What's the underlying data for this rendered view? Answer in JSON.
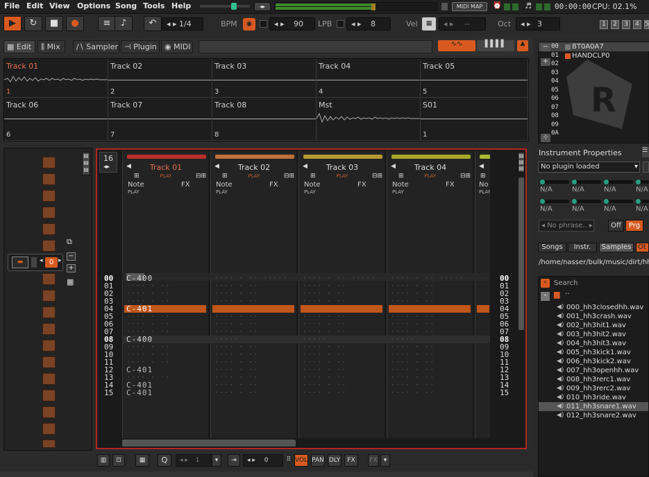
{
  "menu": [
    "File",
    "Edit",
    "View",
    "Options",
    "Song",
    "Tools",
    "Help"
  ],
  "status": {
    "midi_map": "MIDI MAP",
    "time": "00:00:00",
    "cpu": "CPU: 02.1%"
  },
  "toolbar": {
    "lines_per": "1/4",
    "bpm_label": "BPM",
    "bpm": "90",
    "lpb_label": "LPB",
    "lpb": "8",
    "vel_label": "Vel",
    "vel": "--",
    "oct_label": "Oct",
    "oct": "3",
    "tracks": [
      "1",
      "2",
      "3",
      "4",
      "5"
    ]
  },
  "tabs": {
    "edit": "Edit",
    "mix": "Mix",
    "sampler": "Sampler",
    "plugin": "Plugin",
    "midi": "MIDI"
  },
  "mixer": [
    {
      "name": "Track 01",
      "num": "1"
    },
    {
      "name": "Track 02",
      "num": "2"
    },
    {
      "name": "Track 03",
      "num": "3"
    },
    {
      "name": "Track 04",
      "num": "4"
    },
    {
      "name": "Track 05",
      "num": "5"
    },
    {
      "name": "Track 06",
      "num": "6"
    },
    {
      "name": "Track 07",
      "num": "7"
    },
    {
      "name": "Track 08",
      "num": "8"
    },
    {
      "name": "Mst",
      "num": ""
    },
    {
      "name": "S01",
      "num": "1"
    }
  ],
  "sequencer": {
    "pattern": "0",
    "lines": "16"
  },
  "tracks": [
    {
      "name": "Track 01",
      "play": "PLAY",
      "note": "Note",
      "fx": "FX",
      "color": "#b8302a"
    },
    {
      "name": "Track 02",
      "play": "PLAY",
      "note": "Note",
      "fx": "FX",
      "color": "#c0703a"
    },
    {
      "name": "Track 03",
      "play": "PLAY",
      "note": "Note",
      "fx": "FX",
      "color": "#b49a30"
    },
    {
      "name": "Track 04",
      "play": "PLAY",
      "note": "Note",
      "fx": "FX",
      "color": "#a8a82a"
    },
    {
      "name": "",
      "play": "PLAY",
      "note": "No",
      "fx": "",
      "color": "#a8b830"
    }
  ],
  "rows": [
    "00",
    "01",
    "02",
    "03",
    "04",
    "05",
    "06",
    "07",
    "08",
    "09",
    "10",
    "11",
    "12",
    "13",
    "14",
    "15"
  ],
  "notes": {
    "r00": "C-400",
    "r04": "C-401",
    "r08": "C-400",
    "r12": "C-401",
    "r14": "C-401",
    "r15": "C-401"
  },
  "bottom": {
    "quant": "1",
    "step": "0",
    "vol": "VOL",
    "pan": "PAN",
    "dly": "DLY",
    "fx": "FX"
  },
  "instruments": {
    "rows": [
      {
        "idx": "00",
        "name": "BT0A0A7"
      },
      {
        "idx": "01",
        "name": "HANDCLP0"
      },
      {
        "idx": "02",
        "name": ""
      },
      {
        "idx": "03",
        "name": ""
      },
      {
        "idx": "04",
        "name": ""
      },
      {
        "idx": "05",
        "name": ""
      },
      {
        "idx": "06",
        "name": ""
      },
      {
        "idx": "07",
        "name": ""
      },
      {
        "idx": "08",
        "name": ""
      },
      {
        "idx": "09",
        "name": ""
      },
      {
        "idx": "0A",
        "name": ""
      }
    ]
  },
  "props": {
    "title": "Instrument Properties",
    "plugin": "No plugin loaded",
    "na": "N/A",
    "phrase": "No phrase..",
    "off": "Off",
    "prg": "Prg"
  },
  "browser": {
    "tabs": [
      "Songs",
      "Instr.",
      "Samples",
      "Ot"
    ],
    "path": "/home/nasser/bulk/music/dirt/hh/",
    "search": "Search",
    "up": "..",
    "files": [
      "000_hh3closedhh.wav",
      "001_hh3crash.wav",
      "002_hh3hit1.wav",
      "003_hh3hit2.wav",
      "004_hh3hit3.wav",
      "005_hh3kick1.wav",
      "006_hh3kick2.wav",
      "007_hh3openhh.wav",
      "008_hh3rerc1.wav",
      "009_hh3rerc2.wav",
      "010_hh3ride.wav",
      "011_hh3snare1.wav",
      "012_hh3snare2.wav"
    ]
  }
}
